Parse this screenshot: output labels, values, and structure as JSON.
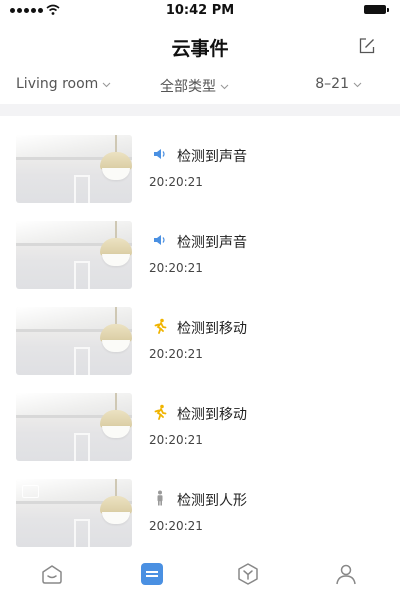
{
  "status_bar": {
    "time": "10:42 PM"
  },
  "header": {
    "title": "云事件",
    "edit_icon": "edit-icon"
  },
  "filters": {
    "room": "Living room",
    "type": "全部类型",
    "date": "8–21"
  },
  "events": [
    {
      "label": "检测到声音",
      "time": "20:20:21",
      "icon": "sound-icon"
    },
    {
      "label": "检测到声音",
      "time": "20:20:21",
      "icon": "sound-icon"
    },
    {
      "label": "检测到移动",
      "time": "20:20:21",
      "icon": "motion-icon"
    },
    {
      "label": "检测到移动",
      "time": "20:20:21",
      "icon": "motion-icon"
    },
    {
      "label": "检测到人形",
      "time": "20:20:21",
      "icon": "person-icon"
    }
  ],
  "bottom_nav": {
    "items": [
      "home-icon",
      "events-icon",
      "discover-icon",
      "profile-icon"
    ],
    "active_color": "#4a90e2",
    "inactive_color": "#888888"
  },
  "colors": {
    "accent": "#4a90e2",
    "motion": "#f0b400",
    "divider_bg": "#f3f3f5"
  }
}
